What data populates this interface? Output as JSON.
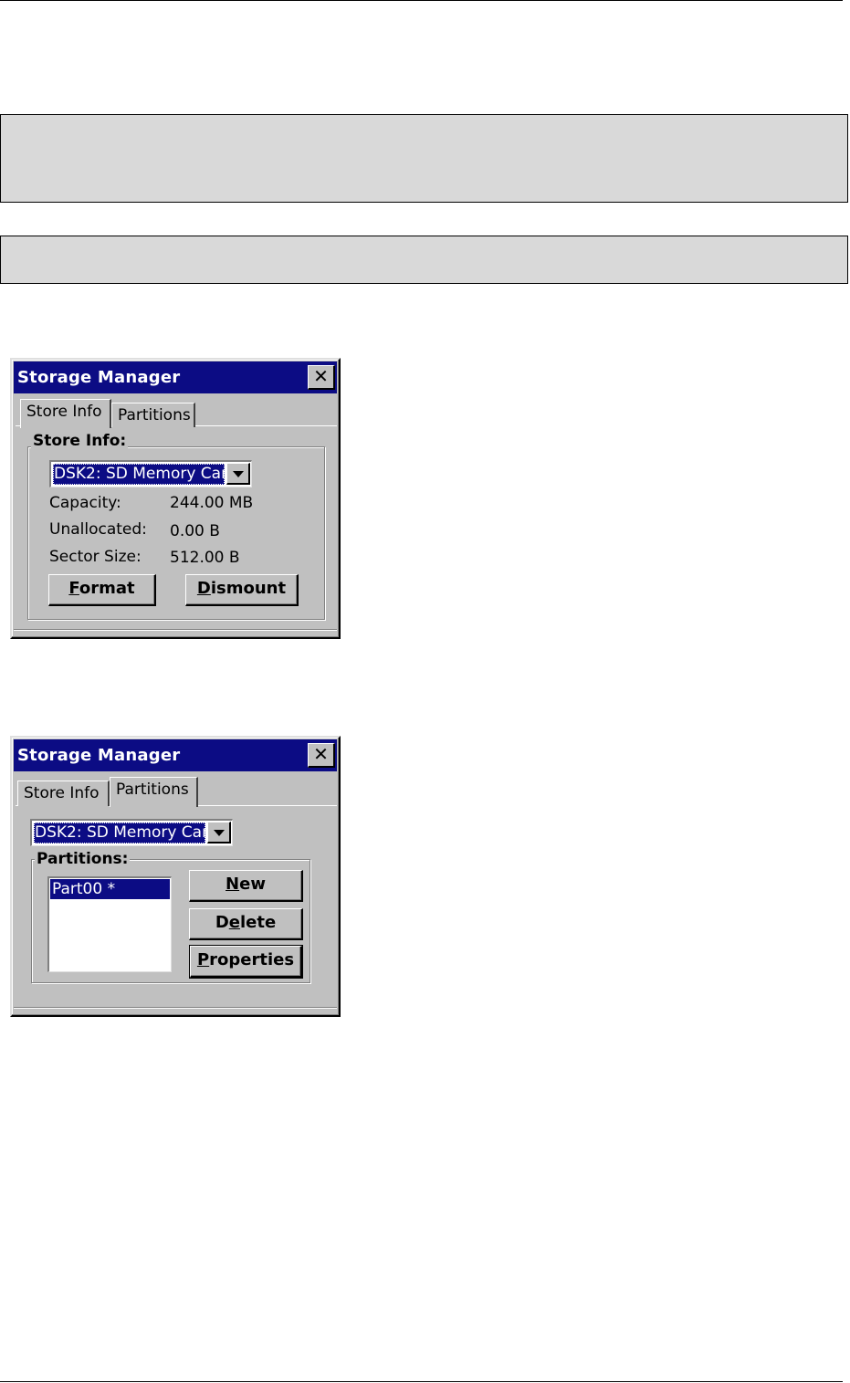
{
  "dialog1": {
    "title": "Storage Manager",
    "close_glyph": "✕",
    "tabs": [
      {
        "label": "Store Info",
        "active": true
      },
      {
        "label": "Partitions",
        "active": false
      }
    ],
    "group_label": "Store Info:",
    "combo_value": "DSK2: SD Memory Car",
    "fields": [
      {
        "label": "Capacity:",
        "value": "244.00 MB"
      },
      {
        "label": "Unallocated:",
        "value": "0.00 B"
      },
      {
        "label": "Sector Size:",
        "value": "512.00 B"
      }
    ],
    "buttons": {
      "format": {
        "mnemonic": "F",
        "rest": "ormat"
      },
      "dismount": {
        "mnemonic": "D",
        "rest": "ismount"
      }
    }
  },
  "dialog2": {
    "title": "Storage Manager",
    "close_glyph": "✕",
    "tabs": [
      {
        "label": "Store Info",
        "active": false
      },
      {
        "label": "Partitions",
        "active": true
      }
    ],
    "combo_value": "DSK2: SD Memory Car",
    "group_label": "Partitions:",
    "partitions": [
      "Part00 *"
    ],
    "buttons": {
      "new": {
        "mnemonic": "N",
        "rest": "ew"
      },
      "delete": {
        "pre": "D",
        "mnemonic": "e",
        "rest": "lete"
      },
      "properties": {
        "mnemonic": "P",
        "rest": "roperties"
      }
    }
  },
  "colors": {
    "titlebar": "#0c0c84",
    "dialog_face": "#c0c0c0",
    "note_box": "#d9d9d9"
  }
}
